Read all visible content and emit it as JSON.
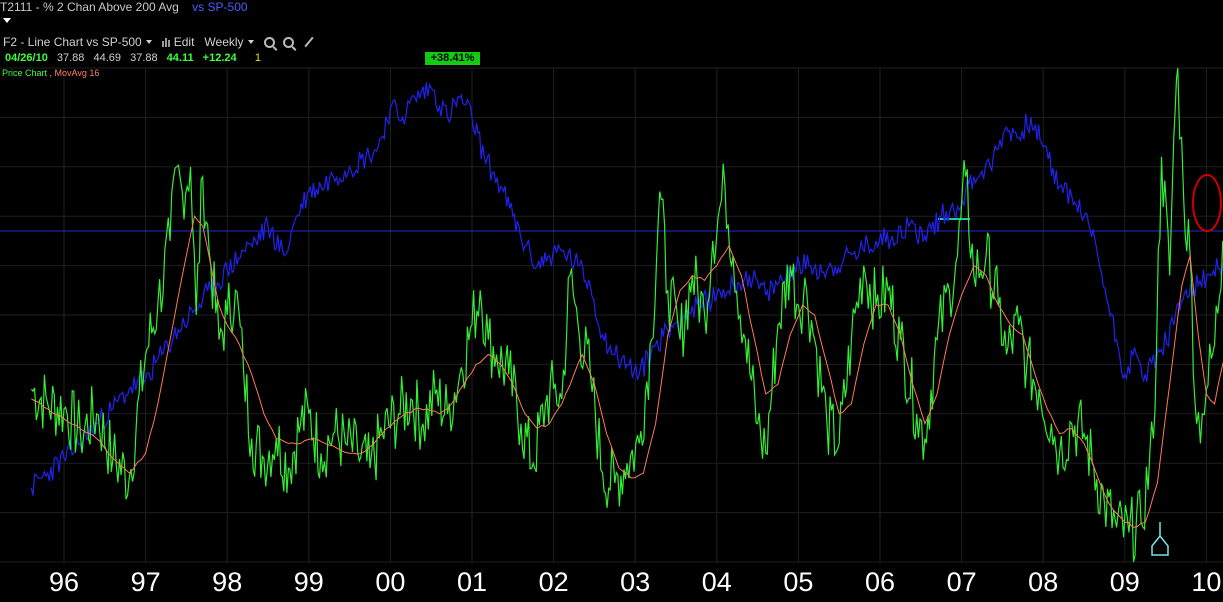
{
  "header": {
    "symbol": "T2111",
    "separator": "-",
    "title": "% 2 Chan Above 200 Avg",
    "vs_label": "vs",
    "comparison": "SP-500"
  },
  "toolbar": {
    "chart_selector": "F2 - Line Chart vs SP-500",
    "edit_label": "Edit",
    "period_selector": "Weekly"
  },
  "quote": {
    "date": "04/26/10",
    "open": "37.88",
    "high": "44.69",
    "low": "37.88",
    "close": "44.11",
    "change": "+12.24",
    "count": "1",
    "pct_change": "+38.41%"
  },
  "legend": {
    "price": "Price Chart",
    "ma": "MovAvg 16"
  },
  "colors": {
    "background": "#000000",
    "t2111_line": "#33ee33",
    "moving_average": "#ff7a55",
    "sp500_line": "#2222ee",
    "hline": "#2828d0",
    "grid": "#1f1f1f",
    "circle": "#cc0000",
    "marker": "#7ae6e6"
  },
  "chart_data": {
    "type": "line",
    "x_tick_labels": [
      "96",
      "97",
      "98",
      "99",
      "00",
      "01",
      "02",
      "03",
      "04",
      "05",
      "06",
      "07",
      "08",
      "09",
      "10"
    ],
    "grid": true,
    "series": [
      {
        "name": "Price Chart",
        "values": [
          [
            1995.6,
            35
          ],
          [
            1995.8,
            32
          ],
          [
            1996.0,
            31
          ],
          [
            1996.2,
            26
          ],
          [
            1996.4,
            30
          ],
          [
            1996.6,
            21
          ],
          [
            1996.8,
            17
          ],
          [
            1997.0,
            42
          ],
          [
            1997.15,
            52
          ],
          [
            1997.3,
            65
          ],
          [
            1997.38,
            80
          ],
          [
            1997.45,
            75
          ],
          [
            1997.55,
            80
          ],
          [
            1997.62,
            50
          ],
          [
            1997.7,
            78
          ],
          [
            1997.8,
            60
          ],
          [
            1997.9,
            45
          ],
          [
            1998.0,
            50
          ],
          [
            1998.1,
            55
          ],
          [
            1998.2,
            39
          ],
          [
            1998.3,
            25
          ],
          [
            1998.45,
            21
          ],
          [
            1998.6,
            25
          ],
          [
            1998.75,
            19
          ],
          [
            1998.9,
            28
          ],
          [
            1999.0,
            30
          ],
          [
            1999.15,
            22
          ],
          [
            1999.3,
            26
          ],
          [
            1999.45,
            24
          ],
          [
            1999.6,
            22
          ],
          [
            1999.75,
            19
          ],
          [
            1999.9,
            26
          ],
          [
            2000.1,
            30
          ],
          [
            2000.25,
            33
          ],
          [
            2000.4,
            28
          ],
          [
            2000.55,
            34
          ],
          [
            2000.7,
            30
          ],
          [
            2000.85,
            38
          ],
          [
            2001.0,
            48
          ],
          [
            2001.1,
            55
          ],
          [
            2001.2,
            45
          ],
          [
            2001.3,
            42
          ],
          [
            2001.45,
            38
          ],
          [
            2001.6,
            28
          ],
          [
            2001.75,
            20
          ],
          [
            2001.9,
            32
          ],
          [
            2002.0,
            35
          ],
          [
            2002.1,
            33
          ],
          [
            2002.2,
            58
          ],
          [
            2002.3,
            48
          ],
          [
            2002.45,
            38
          ],
          [
            2002.6,
            18
          ],
          [
            2002.75,
            16
          ],
          [
            2002.9,
            20
          ],
          [
            2003.05,
            24
          ],
          [
            2003.2,
            45
          ],
          [
            2003.3,
            75
          ],
          [
            2003.4,
            55
          ],
          [
            2003.55,
            45
          ],
          [
            2003.7,
            58
          ],
          [
            2003.85,
            50
          ],
          [
            2003.95,
            65
          ],
          [
            2004.1,
            76
          ],
          [
            2004.2,
            62
          ],
          [
            2004.35,
            45
          ],
          [
            2004.5,
            28
          ],
          [
            2004.6,
            22
          ],
          [
            2004.75,
            48
          ],
          [
            2004.9,
            60
          ],
          [
            2005.0,
            52
          ],
          [
            2005.1,
            55
          ],
          [
            2005.2,
            45
          ],
          [
            2005.35,
            28
          ],
          [
            2005.5,
            24
          ],
          [
            2005.65,
            45
          ],
          [
            2005.8,
            60
          ],
          [
            2005.95,
            52
          ],
          [
            2006.1,
            55
          ],
          [
            2006.25,
            45
          ],
          [
            2006.45,
            30
          ],
          [
            2006.55,
            25
          ],
          [
            2006.7,
            45
          ],
          [
            2006.85,
            55
          ],
          [
            2006.95,
            62
          ],
          [
            2007.05,
            78
          ],
          [
            2007.15,
            58
          ],
          [
            2007.3,
            62
          ],
          [
            2007.45,
            52
          ],
          [
            2007.55,
            42
          ],
          [
            2007.7,
            48
          ],
          [
            2007.8,
            40
          ],
          [
            2007.95,
            35
          ],
          [
            2008.1,
            28
          ],
          [
            2008.2,
            22
          ],
          [
            2008.35,
            28
          ],
          [
            2008.5,
            26
          ],
          [
            2008.6,
            20
          ],
          [
            2008.75,
            12
          ],
          [
            2008.9,
            7
          ],
          [
            2009.05,
            6
          ],
          [
            2009.2,
            8
          ],
          [
            2009.35,
            25
          ],
          [
            2009.45,
            82
          ],
          [
            2009.55,
            58
          ],
          [
            2009.6,
            86
          ],
          [
            2009.65,
            100
          ],
          [
            2009.72,
            74
          ],
          [
            2009.8,
            62
          ],
          [
            2009.88,
            28
          ],
          [
            2009.95,
            30
          ],
          [
            2010.0,
            35
          ],
          [
            2010.1,
            44
          ],
          [
            2010.2,
            65
          ],
          [
            2010.32,
            78
          ],
          [
            2010.36,
            64
          ]
        ]
      },
      {
        "name": "MovAvg 16",
        "values": [
          [
            1995.6,
            33
          ],
          [
            1995.8,
            31
          ],
          [
            1996.0,
            29
          ],
          [
            1996.2,
            27
          ],
          [
            1996.4,
            25
          ],
          [
            1996.6,
            21
          ],
          [
            1996.8,
            18
          ],
          [
            1997.0,
            22
          ],
          [
            1997.15,
            32
          ],
          [
            1997.3,
            45
          ],
          [
            1997.45,
            58
          ],
          [
            1997.6,
            70
          ],
          [
            1997.7,
            68
          ],
          [
            1997.8,
            60
          ],
          [
            1997.9,
            52
          ],
          [
            1998.0,
            48
          ],
          [
            1998.15,
            44
          ],
          [
            1998.3,
            38
          ],
          [
            1998.45,
            30
          ],
          [
            1998.6,
            25
          ],
          [
            1998.75,
            24
          ],
          [
            1998.9,
            24
          ],
          [
            1999.05,
            25
          ],
          [
            1999.2,
            24
          ],
          [
            1999.35,
            23
          ],
          [
            1999.5,
            22
          ],
          [
            1999.65,
            22
          ],
          [
            1999.8,
            24
          ],
          [
            1999.95,
            27
          ],
          [
            2000.1,
            29
          ],
          [
            2000.3,
            31
          ],
          [
            2000.45,
            31
          ],
          [
            2000.6,
            30
          ],
          [
            2000.75,
            32
          ],
          [
            2000.9,
            36
          ],
          [
            2001.05,
            40
          ],
          [
            2001.2,
            42
          ],
          [
            2001.35,
            40
          ],
          [
            2001.5,
            36
          ],
          [
            2001.65,
            30
          ],
          [
            2001.8,
            27
          ],
          [
            2001.95,
            28
          ],
          [
            2002.1,
            32
          ],
          [
            2002.25,
            38
          ],
          [
            2002.35,
            42
          ],
          [
            2002.5,
            36
          ],
          [
            2002.65,
            26
          ],
          [
            2002.8,
            19
          ],
          [
            2002.95,
            17
          ],
          [
            2003.1,
            18
          ],
          [
            2003.25,
            28
          ],
          [
            2003.4,
            46
          ],
          [
            2003.55,
            55
          ],
          [
            2003.7,
            58
          ],
          [
            2003.85,
            57
          ],
          [
            2004.0,
            60
          ],
          [
            2004.15,
            64
          ],
          [
            2004.3,
            58
          ],
          [
            2004.45,
            46
          ],
          [
            2004.6,
            34
          ],
          [
            2004.75,
            36
          ],
          [
            2004.9,
            46
          ],
          [
            2005.05,
            52
          ],
          [
            2005.2,
            50
          ],
          [
            2005.35,
            40
          ],
          [
            2005.5,
            30
          ],
          [
            2005.65,
            32
          ],
          [
            2005.8,
            44
          ],
          [
            2005.95,
            52
          ],
          [
            2006.1,
            52
          ],
          [
            2006.25,
            46
          ],
          [
            2006.4,
            36
          ],
          [
            2006.55,
            28
          ],
          [
            2006.7,
            34
          ],
          [
            2006.85,
            46
          ],
          [
            2007.0,
            54
          ],
          [
            2007.15,
            60
          ],
          [
            2007.3,
            58
          ],
          [
            2007.45,
            52
          ],
          [
            2007.6,
            48
          ],
          [
            2007.75,
            46
          ],
          [
            2007.9,
            38
          ],
          [
            2008.05,
            31
          ],
          [
            2008.2,
            26
          ],
          [
            2008.35,
            27
          ],
          [
            2008.5,
            24
          ],
          [
            2008.65,
            18
          ],
          [
            2008.8,
            12
          ],
          [
            2008.95,
            9
          ],
          [
            2009.1,
            7
          ],
          [
            2009.25,
            8
          ],
          [
            2009.4,
            16
          ],
          [
            2009.55,
            36
          ],
          [
            2009.7,
            56
          ],
          [
            2009.8,
            62
          ],
          [
            2009.9,
            46
          ],
          [
            2010.0,
            34
          ],
          [
            2010.1,
            32
          ],
          [
            2010.2,
            40
          ],
          [
            2010.3,
            46
          ],
          [
            2010.36,
            48
          ]
        ]
      },
      {
        "name": "SP-500",
        "values": [
          [
            1995.6,
            15
          ],
          [
            1995.8,
            18
          ],
          [
            1996.0,
            21
          ],
          [
            1996.2,
            24
          ],
          [
            1996.4,
            28
          ],
          [
            1996.6,
            31
          ],
          [
            1996.8,
            35
          ],
          [
            1997.0,
            37
          ],
          [
            1997.2,
            42
          ],
          [
            1997.4,
            47
          ],
          [
            1997.6,
            51
          ],
          [
            1997.8,
            55
          ],
          [
            1998.0,
            59
          ],
          [
            1998.2,
            63
          ],
          [
            1998.35,
            65
          ],
          [
            1998.5,
            68
          ],
          [
            1998.7,
            62
          ],
          [
            1998.85,
            70
          ],
          [
            1999.0,
            75
          ],
          [
            1999.15,
            76
          ],
          [
            1999.3,
            78
          ],
          [
            1999.5,
            80
          ],
          [
            1999.7,
            82
          ],
          [
            1999.85,
            84
          ],
          [
            2000.0,
            92
          ],
          [
            2000.15,
            90
          ],
          [
            2000.3,
            94
          ],
          [
            2000.5,
            96
          ],
          [
            2000.7,
            90
          ],
          [
            2000.85,
            94
          ],
          [
            2001.0,
            90
          ],
          [
            2001.15,
            82
          ],
          [
            2001.35,
            76
          ],
          [
            2001.5,
            70
          ],
          [
            2001.65,
            64
          ],
          [
            2001.8,
            60
          ],
          [
            2001.95,
            62
          ],
          [
            2002.1,
            63
          ],
          [
            2002.3,
            60
          ],
          [
            2002.45,
            56
          ],
          [
            2002.6,
            46
          ],
          [
            2002.75,
            42
          ],
          [
            2002.9,
            40
          ],
          [
            2003.05,
            38
          ],
          [
            2003.25,
            44
          ],
          [
            2003.4,
            47
          ],
          [
            2003.6,
            50
          ],
          [
            2003.8,
            52
          ],
          [
            2004.0,
            54
          ],
          [
            2004.2,
            56
          ],
          [
            2004.4,
            58
          ],
          [
            2004.6,
            54
          ],
          [
            2004.8,
            57
          ],
          [
            2004.95,
            60
          ],
          [
            2005.15,
            60
          ],
          [
            2005.35,
            59
          ],
          [
            2005.55,
            61
          ],
          [
            2005.75,
            63
          ],
          [
            2005.95,
            65
          ],
          [
            2006.15,
            66
          ],
          [
            2006.35,
            68
          ],
          [
            2006.55,
            66
          ],
          [
            2006.75,
            70
          ],
          [
            2006.95,
            72
          ],
          [
            2007.15,
            78
          ],
          [
            2007.35,
            80
          ],
          [
            2007.55,
            88
          ],
          [
            2007.7,
            86
          ],
          [
            2007.85,
            90
          ],
          [
            2008.0,
            84
          ],
          [
            2008.2,
            76
          ],
          [
            2008.35,
            74
          ],
          [
            2008.5,
            70
          ],
          [
            2008.65,
            64
          ],
          [
            2008.8,
            52
          ],
          [
            2008.9,
            45
          ],
          [
            2009.0,
            38
          ],
          [
            2009.1,
            42
          ],
          [
            2009.25,
            38
          ],
          [
            2009.45,
            43
          ],
          [
            2009.6,
            48
          ],
          [
            2009.75,
            55
          ],
          [
            2009.9,
            56
          ],
          [
            2010.05,
            58
          ],
          [
            2010.2,
            60
          ],
          [
            2010.35,
            62
          ]
        ]
      }
    ],
    "reference_line": 67
  }
}
